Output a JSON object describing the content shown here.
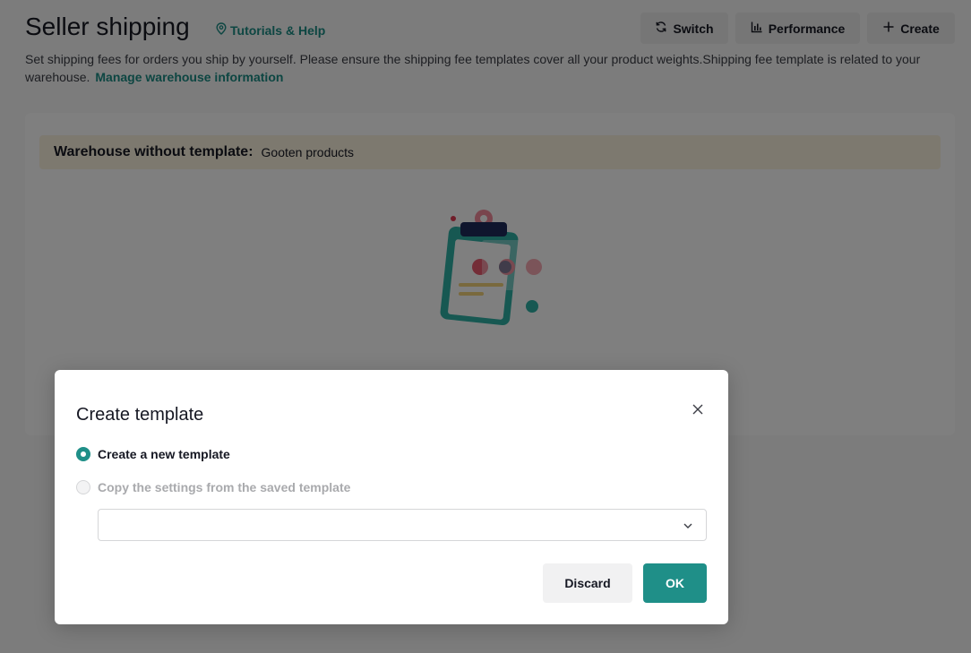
{
  "header": {
    "title": "Seller shipping",
    "help_link": "Tutorials & Help",
    "description": "Set shipping fees for orders you ship by yourself. Please ensure the shipping fee templates cover all your product weights.Shipping fee template is related to your warehouse.",
    "manage_link": "Manage warehouse information"
  },
  "toolbar": {
    "switch_label": "Switch",
    "performance_label": "Performance",
    "create_label": "Create"
  },
  "banner": {
    "label": "Warehouse without template:",
    "value": "Gooten products"
  },
  "modal": {
    "title": "Create template",
    "options": [
      {
        "label": "Create a new template",
        "checked": true,
        "disabled": false
      },
      {
        "label": "Copy the settings from the saved template",
        "checked": false,
        "disabled": true
      }
    ],
    "select_value": "",
    "discard_label": "Discard",
    "ok_label": "OK"
  },
  "colors": {
    "accent": "#1f8f88",
    "link": "#1a8c85",
    "banner_bg": "#fbf3de"
  },
  "icons": {
    "help": "pin-icon",
    "switch": "refresh-icon",
    "performance": "bar-chart-icon",
    "create": "plus-icon",
    "close": "close-icon",
    "dropdown": "chevron-down-icon",
    "empty": "clipboard-illustration-icon"
  }
}
